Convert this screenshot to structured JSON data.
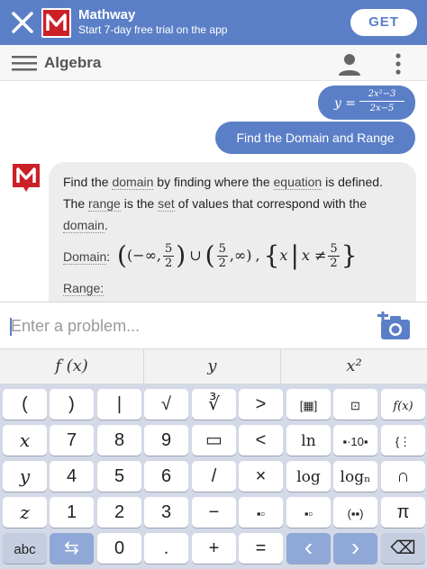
{
  "banner": {
    "app_name": "Mathway",
    "subtitle": "Start 7-day free trial on the app",
    "get_label": "GET",
    "logo_text": "M"
  },
  "header": {
    "title": "Algebra"
  },
  "chat": {
    "user_equation": {
      "lhs": "y =",
      "numerator": "2x²−3",
      "denominator": "2x−5"
    },
    "user_question": "Find the Domain and Range",
    "answer": {
      "sentence_parts": [
        "Find the ",
        "domain",
        " by finding where the ",
        "equation",
        " is defined. The ",
        "range",
        " is the ",
        "set",
        " of values that correspond with the ",
        "domain",
        "."
      ],
      "domain_label": "Domain",
      "domain_expr": {
        "p1_open": "(−∞,",
        "f1_num": "5",
        "f1_den": "2",
        "p1_close": ")",
        "union": "∪",
        "p2_open": "(",
        "f2_num": "5",
        "f2_den": "2",
        "p2_close": ",∞)",
        "comma": ",",
        "set_open": "{",
        "set_var": "x",
        "set_bar": "|",
        "set_cond": "x ≠",
        "f3_num": "5",
        "f3_den": "2",
        "set_close": "}"
      },
      "range_label": "Range:"
    }
  },
  "input": {
    "placeholder": "Enter a problem..."
  },
  "modes": [
    "f (x)",
    "y",
    "x²"
  ],
  "keyboard": {
    "rows": [
      [
        "(",
        ")",
        "|",
        "√",
        "∛",
        ">",
        "[▦]",
        "⊡",
        "f(x)"
      ],
      [
        "x",
        "7",
        "8",
        "9",
        "▭",
        "<",
        "ln",
        "▪·10▪",
        "{⋮"
      ],
      [
        "y",
        "4",
        "5",
        "6",
        "/",
        "×",
        "log",
        "logₙ",
        "∩"
      ],
      [
        "z",
        "1",
        "2",
        "3",
        "−",
        "▪▫",
        "▪▫",
        "(▪▪)",
        "π"
      ],
      [
        "abc",
        "⇆",
        "0",
        ".",
        "+",
        "=",
        "‹",
        "›",
        "⌫"
      ]
    ]
  },
  "colors": {
    "brand": "#5b7fc7",
    "logo_red": "#cc2027",
    "keyboard_bg": "#d3d9e6",
    "key_blue": "#8fa8d8"
  }
}
